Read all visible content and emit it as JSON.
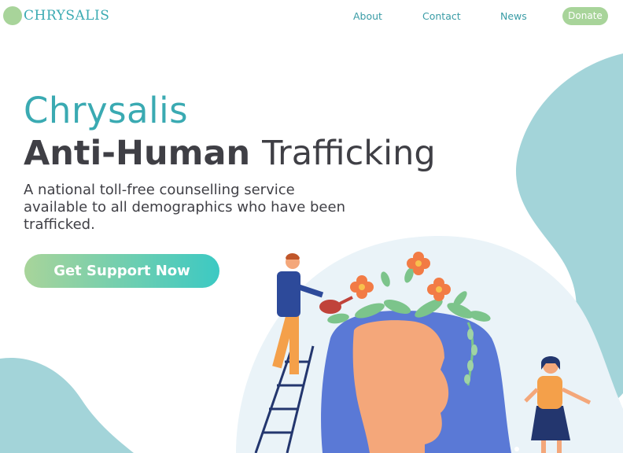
{
  "brand": {
    "name": "CHRYSALIS",
    "logo_icon": "circle-logo-icon",
    "color": "#a8d49a"
  },
  "nav": {
    "items": [
      {
        "label": "About"
      },
      {
        "label": "Contact"
      },
      {
        "label": "News"
      }
    ],
    "donate_label": "Donate"
  },
  "hero": {
    "title": "Chrysalis",
    "subtitle_bold": "Anti-Human",
    "subtitle_light": "Trafficking",
    "description": "A national  toll-free counselling service available to all demographics who have been trafficked.",
    "cta_label": "Get Support Now"
  },
  "colors": {
    "accent_teal": "#3aaab2",
    "accent_green": "#a8d49a",
    "blob": "#a3d4d9",
    "text_dark": "#3f3f45",
    "head_blue": "#5a79d6",
    "skin": "#f4a77a",
    "flower_orange": "#f27b45"
  },
  "illustration": {
    "subject": "person-head-with-flowers-illustration",
    "figures": [
      "man-on-ladder-watering-icon",
      "woman-figure-icon"
    ]
  }
}
